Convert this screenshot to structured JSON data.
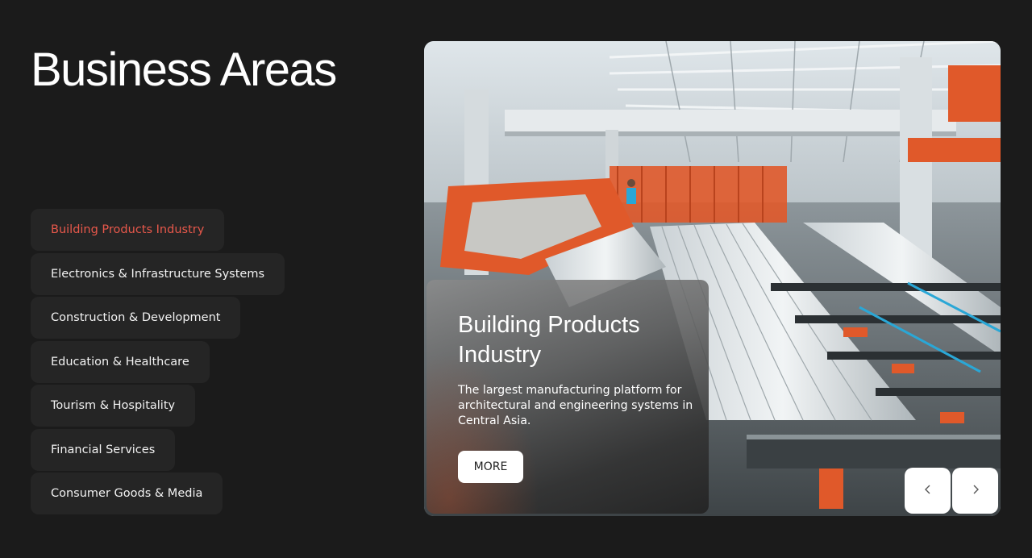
{
  "page": {
    "title": "Business Areas"
  },
  "business_areas": {
    "items": [
      {
        "label": "Building Products Industry",
        "active": true
      },
      {
        "label": "Electronics & Infrastructure Systems",
        "active": false
      },
      {
        "label": "Construction & Development",
        "active": false
      },
      {
        "label": "Education & Healthcare",
        "active": false
      },
      {
        "label": "Tourism & Hospitality",
        "active": false
      },
      {
        "label": "Financial Services",
        "active": false
      },
      {
        "label": "Consumer Goods & Media",
        "active": false
      }
    ]
  },
  "feature": {
    "title": "Building Products Industry",
    "description": "The largest manufacturing platform for architectural and engineering systems in Central Asia.",
    "more_label": "MORE",
    "image": "factory-aluminium-profiles-photo",
    "prev_icon": "chevron-left-icon",
    "next_icon": "chevron-right-icon"
  },
  "colors": {
    "background": "#1b1b1b",
    "item_background": "#252525",
    "active_item_text": "#e8584b",
    "accent_orange": "#e0592a"
  }
}
